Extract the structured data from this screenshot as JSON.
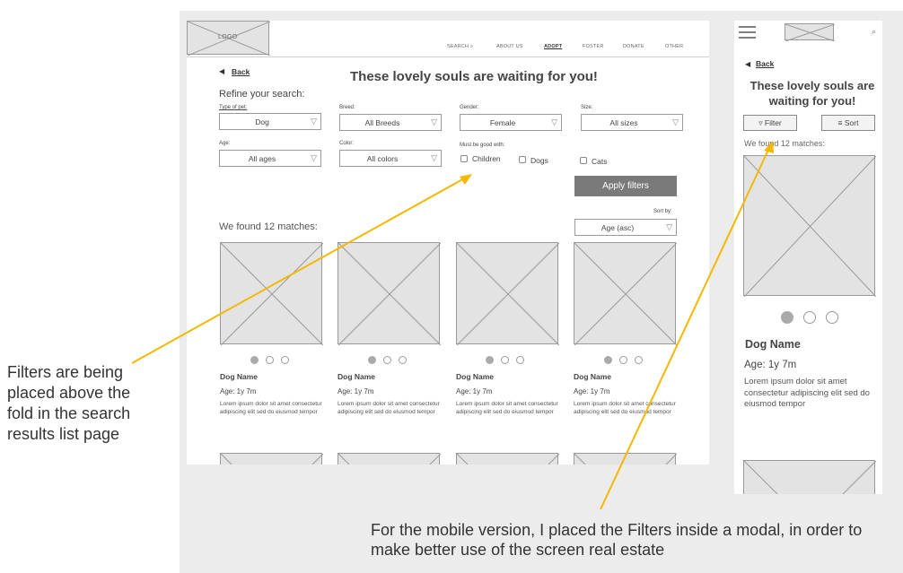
{
  "colors": {
    "annotation_arrow": "#f5b800",
    "placeholder_fill": "#e3e3e3",
    "button_fill": "#7a7a7a"
  },
  "desktop": {
    "logo": "LOGO",
    "nav": [
      {
        "label": "SEARCH",
        "icon": "search-icon"
      },
      {
        "label": "ABOUT US"
      },
      {
        "label": "ADOPT",
        "active": true
      },
      {
        "label": "FOSTER"
      },
      {
        "label": "DONATE"
      },
      {
        "label": "OTHER"
      }
    ],
    "back": "Back",
    "title": "These lovely souls are waiting for you!",
    "refine": "Refine your search:",
    "filters": {
      "type": {
        "label": "Type of pet:",
        "value": "Dog"
      },
      "breed": {
        "label": "Breed:",
        "value": "All Breeds"
      },
      "gender": {
        "label": "Gender:",
        "value": "Female"
      },
      "size": {
        "label": "Size:",
        "value": "All sizes"
      },
      "age": {
        "label": "Age:",
        "value": "All ages"
      },
      "color": {
        "label": "Color:",
        "value": "All colors"
      },
      "good_with": {
        "label": "Must be good with:",
        "options": [
          "Children",
          "Dogs",
          "Cats"
        ]
      }
    },
    "apply": "Apply filters",
    "sort": {
      "label": "Sort by:",
      "value": "Age (asc)"
    },
    "matches": "We found 12 matches:",
    "card": {
      "name": "Dog Name",
      "age": "Age: 1y 7m",
      "lorem": "Lorem ipsum dolor sit amet consectetur adipiscing elit sed do eiusmod tempor"
    }
  },
  "mobile": {
    "back": "Back",
    "title": "These lovely souls are waiting for you!",
    "filter": "Filter",
    "sort": "Sort",
    "matches": "We found 12 matches:",
    "card": {
      "name": "Dog Name",
      "age": "Age: 1y 7m",
      "lorem": "Lorem ipsum dolor sit amet consectetur adipiscing elit sed do eiusmod tempor"
    }
  },
  "annotations": {
    "left": "Filters are being placed above the fold in the search results list page",
    "bottom": "For the mobile version, I placed the Filters inside a modal, in order to make better use of the screen real estate"
  }
}
